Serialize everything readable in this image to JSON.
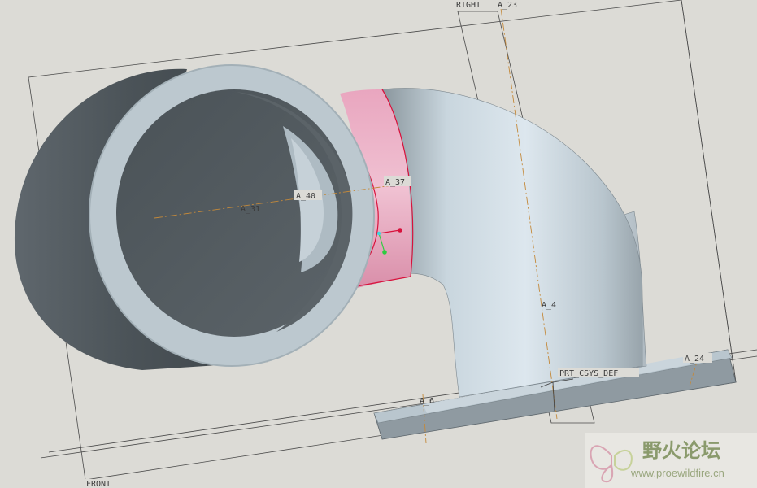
{
  "viewport": {
    "background": "#dcdbd6",
    "model_color": "#b6c3cb",
    "highlight_color": "#e28fab",
    "selection_color": "#d8123c",
    "datum_line_color": "#c4893a"
  },
  "datum_planes": {
    "right": "RIGHT",
    "front": "FRONT"
  },
  "datum_axes": {
    "a23": "A_23",
    "a31": "A_31",
    "a40": "A_40",
    "a37": "A_37",
    "a4": "A_4",
    "a24": "A_24",
    "a6": "A_6"
  },
  "csys": {
    "name": "PRT_CSYS_DEF"
  },
  "watermark": {
    "icon": "butterfly-logo-icon",
    "title": "野火论坛",
    "url": "www.proewildfire.cn"
  }
}
